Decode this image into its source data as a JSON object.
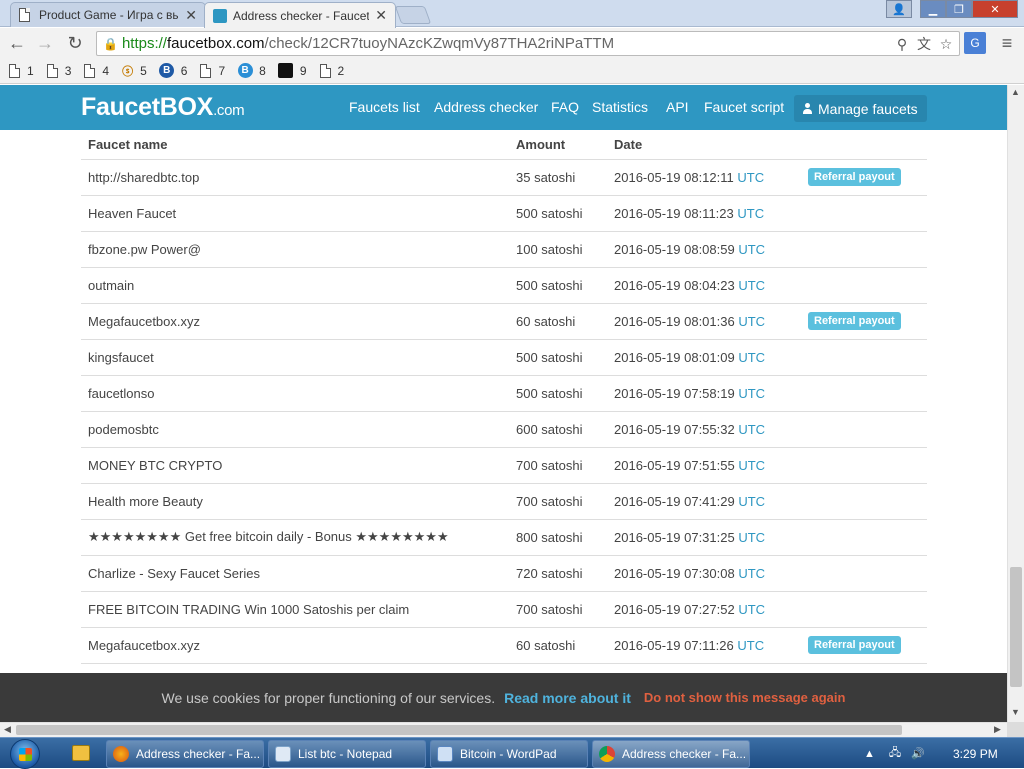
{
  "browser": {
    "tabs": [
      {
        "title": "Product Game - Игра с вы",
        "active": false
      },
      {
        "title": "Address checker - FaucetB",
        "active": true
      }
    ],
    "url": {
      "scheme": "https://",
      "host": "faucetbox.com",
      "path": "/check/12CR7tuoyNAzcKZwqmVy87THA2riNPaTTM"
    },
    "bookmarks": [
      {
        "label": "1",
        "icon": "doc-icon"
      },
      {
        "label": "3",
        "icon": "doc-icon"
      },
      {
        "label": "4",
        "icon": "doc-icon"
      },
      {
        "label": "5",
        "icon": "site-icon"
      },
      {
        "label": "6",
        "icon": "bitcoin-icon"
      },
      {
        "label": "7",
        "icon": "doc-icon"
      },
      {
        "label": "8",
        "icon": "bitcoin-icon"
      },
      {
        "label": "9",
        "icon": "site-icon"
      },
      {
        "label": "2",
        "icon": "doc-icon"
      }
    ]
  },
  "site": {
    "logo_main": "FaucetBOX",
    "logo_suffix": ".com",
    "nav": [
      {
        "label": "Faucets list"
      },
      {
        "label": "Address checker"
      },
      {
        "label": "FAQ"
      },
      {
        "label": "Statistics"
      },
      {
        "label": "API"
      },
      {
        "label": "Faucet script"
      }
    ],
    "manage_label": "Manage faucets"
  },
  "table": {
    "headers": [
      "Faucet name",
      "Amount",
      "Date",
      ""
    ],
    "rows": [
      {
        "name": "http://sharedbtc.top",
        "amount": "35 satoshi",
        "date": "2016-05-19 08:12:11",
        "tz": "UTC",
        "badge": "Referral payout"
      },
      {
        "name": "Heaven Faucet",
        "amount": "500 satoshi",
        "date": "2016-05-19 08:11:23",
        "tz": "UTC",
        "badge": ""
      },
      {
        "name": "fbzone.pw Power@",
        "amount": "100 satoshi",
        "date": "2016-05-19 08:08:59",
        "tz": "UTC",
        "badge": ""
      },
      {
        "name": "outmain",
        "amount": "500 satoshi",
        "date": "2016-05-19 08:04:23",
        "tz": "UTC",
        "badge": ""
      },
      {
        "name": "Megafaucetbox.xyz",
        "amount": "60 satoshi",
        "date": "2016-05-19 08:01:36",
        "tz": "UTC",
        "badge": "Referral payout"
      },
      {
        "name": "kingsfaucet",
        "amount": "500 satoshi",
        "date": "2016-05-19 08:01:09",
        "tz": "UTC",
        "badge": ""
      },
      {
        "name": "faucetlonso",
        "amount": "500 satoshi",
        "date": "2016-05-19 07:58:19",
        "tz": "UTC",
        "badge": ""
      },
      {
        "name": "podemosbtc",
        "amount": "600 satoshi",
        "date": "2016-05-19 07:55:32",
        "tz": "UTC",
        "badge": ""
      },
      {
        "name": "MONEY BTC CRYPTO",
        "amount": "700 satoshi",
        "date": "2016-05-19 07:51:55",
        "tz": "UTC",
        "badge": ""
      },
      {
        "name": "Health more Beauty",
        "amount": "700 satoshi",
        "date": "2016-05-19 07:41:29",
        "tz": "UTC",
        "badge": ""
      },
      {
        "name": "★★★★★★★★ Get free bitcoin daily - Bonus ★★★★★★★★",
        "amount": "800 satoshi",
        "date": "2016-05-19 07:31:25",
        "tz": "UTC",
        "badge": ""
      },
      {
        "name": "Charlize - Sexy Faucet Series",
        "amount": "720 satoshi",
        "date": "2016-05-19 07:30:08",
        "tz": "UTC",
        "badge": ""
      },
      {
        "name": "FREE BITCOIN TRADING Win 1000 Satoshis per claim",
        "amount": "700 satoshi",
        "date": "2016-05-19 07:27:52",
        "tz": "UTC",
        "badge": ""
      },
      {
        "name": "Megafaucetbox.xyz",
        "amount": "60 satoshi",
        "date": "2016-05-19 07:11:26",
        "tz": "UTC",
        "badge": "Referral payout"
      }
    ]
  },
  "cookie_bar": {
    "message": "We use cookies for proper functioning of our services.",
    "more_link": "Read more about it",
    "dismiss_link": "Do not show this message again"
  },
  "taskbar": {
    "buttons": [
      {
        "label": "Address checker - Fa...",
        "icon": "firefox-icon"
      },
      {
        "label": "List btc - Notepad",
        "icon": "notepad-icon"
      },
      {
        "label": "Bitcoin - WordPad",
        "icon": "wordpad-icon"
      },
      {
        "label": "Address checker - Fa...",
        "icon": "chrome-icon"
      }
    ],
    "clock": "3:29 PM"
  },
  "colors": {
    "site_header": "#2e97c2",
    "badge": "#5bc0de",
    "link_blue": "#4fb3dd",
    "dismiss_red": "#e06040",
    "cookie_bg": "#3a3a3a"
  }
}
